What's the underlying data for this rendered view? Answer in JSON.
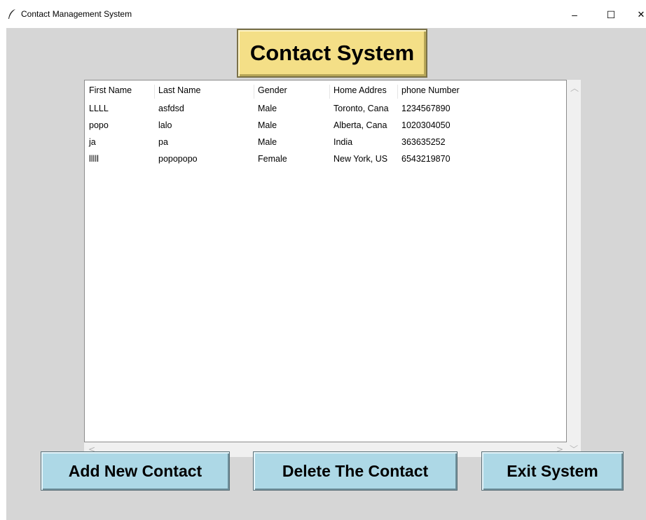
{
  "window": {
    "title": "Contact Management System",
    "minimize": "–",
    "maximize": "☐",
    "close": "✕"
  },
  "header": {
    "title": "Contact System"
  },
  "table": {
    "columns": [
      "First Name",
      "Last Name",
      "Gender",
      "Home Addres",
      "phone Number"
    ],
    "rows": [
      [
        "LLLL",
        "asfdsd",
        "Male",
        "Toronto, Cana",
        "1234567890"
      ],
      [
        "popo",
        "lalo",
        "Male",
        "Alberta, Cana",
        "1020304050"
      ],
      [
        "ja",
        "pa",
        "Male",
        "India",
        "363635252"
      ],
      [
        "lllll",
        "popopopo",
        "Female",
        "New York, US",
        "6543219870"
      ]
    ]
  },
  "buttons": {
    "add": "Add New Contact",
    "delete": "Delete The Contact",
    "exit": "Exit System"
  },
  "colors": {
    "header_bg": "#f4df87",
    "button_bg": "#add8e6",
    "window_bg": "#d6d6d6"
  }
}
